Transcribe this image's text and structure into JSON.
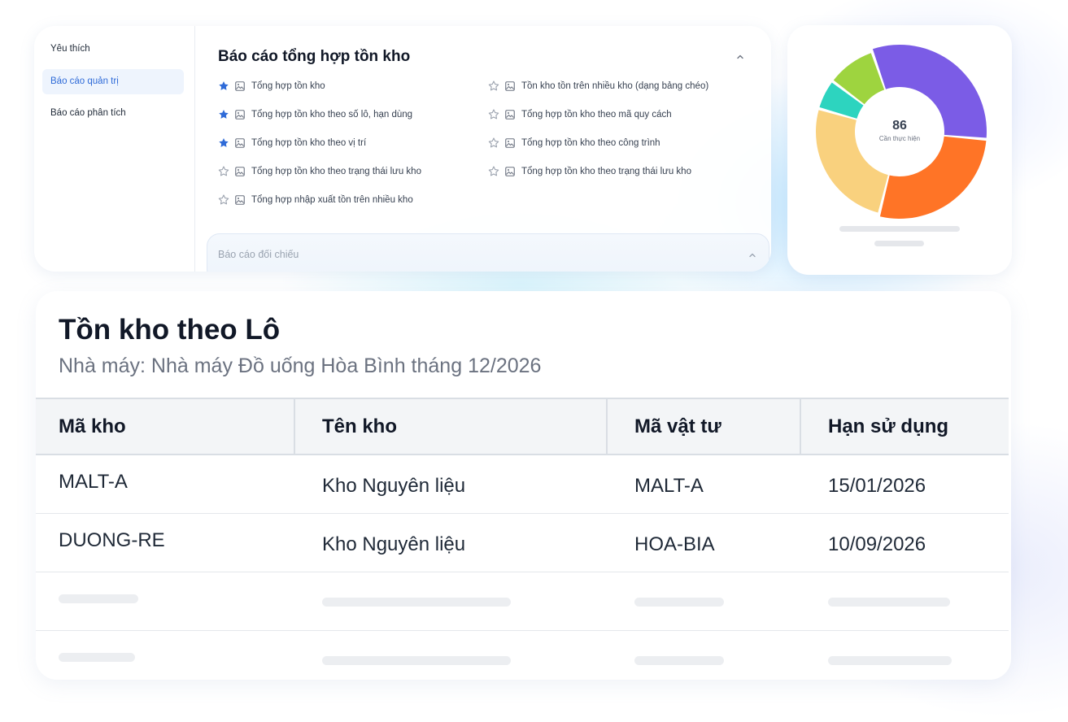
{
  "report_panel": {
    "nav": [
      {
        "label": "Yêu thích",
        "active": false
      },
      {
        "label": "Báo cáo quản trị",
        "active": true
      },
      {
        "label": "Báo cáo phân tích",
        "active": false
      }
    ],
    "section_title": "Báo cáo tổng hợp tồn kho",
    "reports_left": [
      {
        "label": "Tổng hợp tồn kho",
        "favorite": true
      },
      {
        "label": "Tổng hợp tồn kho theo số lô, hạn dùng",
        "favorite": true
      },
      {
        "label": "Tổng hợp tồn kho theo vị trí",
        "favorite": true
      },
      {
        "label": "Tổng hợp tồn kho theo trạng thái lưu kho",
        "favorite": false
      },
      {
        "label": "Tổng hợp nhập xuất tồn trên nhiều kho",
        "favorite": false
      }
    ],
    "reports_right": [
      {
        "label": "Tồn kho tồn trên nhiều kho (dạng bảng chéo)",
        "favorite": false
      },
      {
        "label": "Tổng hợp tồn kho theo mã quy cách",
        "favorite": false
      },
      {
        "label": "Tổng hợp tồn kho theo công trình",
        "favorite": false
      },
      {
        "label": "Tổng hợp tồn kho theo trạng thái lưu kho",
        "favorite": false
      }
    ],
    "collapsed_section_title": "Báo cáo đối chiếu"
  },
  "chart_card": {
    "center_value": "86",
    "center_caption": "Cần thực hiện",
    "colors": {
      "purple": "#7b5ce6",
      "orange": "#ff7426",
      "peach": "#f9d17e",
      "teal": "#2dd4bf",
      "green": "#9ed43f"
    }
  },
  "table": {
    "title": "Tồn kho theo Lô",
    "subtitle": "Nhà máy: Nhà máy Đồ uống Hòa Bình tháng 12/2026",
    "headers": [
      "Mã kho",
      "Tên kho",
      "Mã vật tư",
      "Hạn sử dụng"
    ],
    "rows": [
      [
        "MALT-A",
        "Kho Nguyên liệu",
        "MALT-A",
        "15/01/2026"
      ],
      [
        "DUONG-RE",
        "Kho Nguyên liệu",
        "HOA-BIA",
        "10/09/2026"
      ]
    ]
  },
  "colors": {
    "accent": "#2f6bd8",
    "star_filled": "#2f6bd8",
    "star_empty": "#9ca3af"
  }
}
